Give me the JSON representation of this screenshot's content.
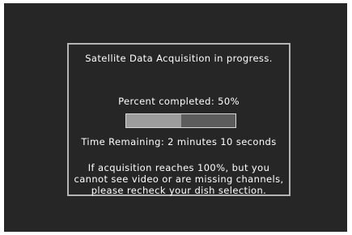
{
  "dialog": {
    "title": "Satellite Data Acquisition in progress.",
    "percent_text": "Percent completed: 50%",
    "progress_fraction": 0.5,
    "time_remaining_text": "Time Remaining: 2 minutes 10 seconds",
    "notice_lines": [
      "If acquisition reaches 100%, but you",
      "cannot see video or are missing channels,",
      "please recheck your dish selection."
    ]
  },
  "colors": {
    "screen_background": "#262626",
    "dialog_border": "#b4b4b4",
    "progress_fill": "#9c9c9c",
    "progress_track": "#5c5c5c",
    "text": "#ffffff"
  }
}
